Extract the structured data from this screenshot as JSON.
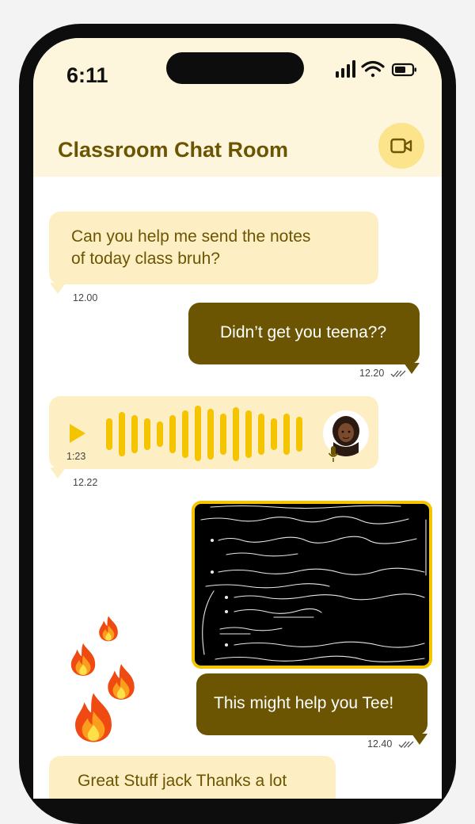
{
  "status_bar": {
    "time": "6:11"
  },
  "header": {
    "title": "Classroom Chat Room",
    "video_icon": "video-camera-icon"
  },
  "colors": {
    "accent_dark": "#6b5502",
    "bubble_light": "#fdefc3",
    "header_bg": "#fdf6dc",
    "image_border": "#f5c400"
  },
  "messages": [
    {
      "type": "text",
      "direction": "in",
      "lines": [
        "Can you help me send the notes",
        "of today class bruh?"
      ],
      "time": "12.00"
    },
    {
      "type": "text",
      "direction": "out",
      "text": "Didn’t get you teena??",
      "time": "12.20"
    },
    {
      "type": "voice",
      "direction": "in",
      "duration": "1:23",
      "time": "12.22",
      "icons": [
        "play-icon",
        "waveform-icon",
        "avatar",
        "microphone-icon"
      ]
    },
    {
      "type": "image",
      "direction": "out",
      "icon": "handwritten-notes-image"
    },
    {
      "type": "text",
      "direction": "out",
      "text": "This might help you Tee!",
      "time": "12.40"
    },
    {
      "type": "text",
      "direction": "in",
      "text": "Great Stuff jack Thanks a lot"
    }
  ],
  "decorations": [
    "fire-emoji"
  ],
  "notes_image": {
    "lines": []
  }
}
